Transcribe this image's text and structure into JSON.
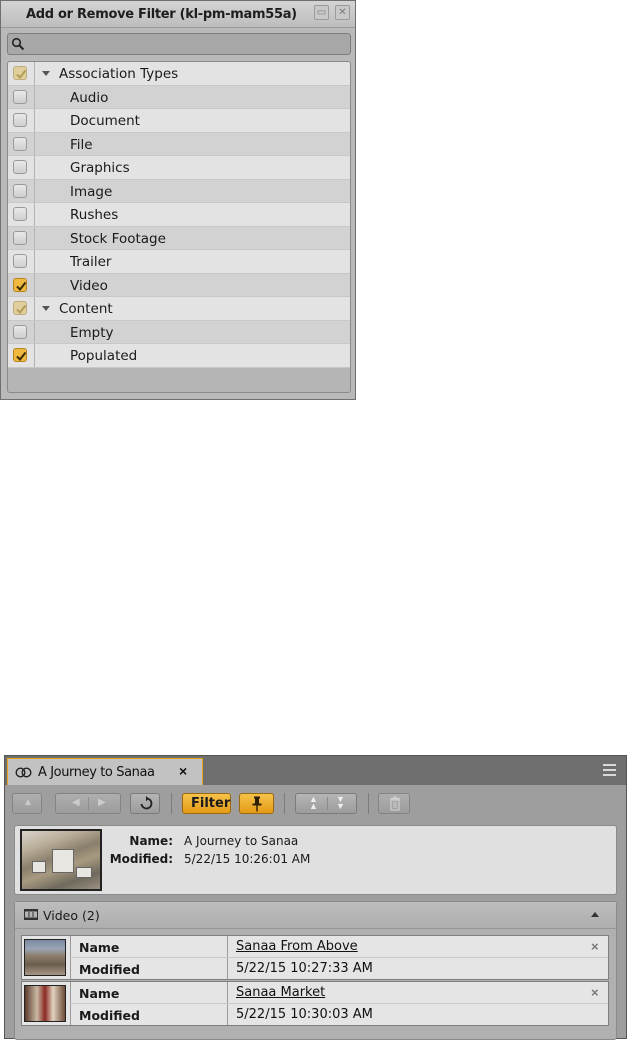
{
  "filter_dialog": {
    "title": "Add or Remove Filter  (kl-pm-mam55a)",
    "search": {
      "value": "",
      "placeholder": ""
    },
    "rows": [
      {
        "label": "Association Types",
        "state": "partial",
        "group": true
      },
      {
        "label": "Audio",
        "state": "unchecked",
        "group": false
      },
      {
        "label": "Document",
        "state": "unchecked",
        "group": false
      },
      {
        "label": "File",
        "state": "unchecked",
        "group": false
      },
      {
        "label": "Graphics",
        "state": "unchecked",
        "group": false
      },
      {
        "label": "Image",
        "state": "unchecked",
        "group": false
      },
      {
        "label": "Rushes",
        "state": "unchecked",
        "group": false
      },
      {
        "label": "Stock Footage",
        "state": "unchecked",
        "group": false
      },
      {
        "label": "Trailer",
        "state": "unchecked",
        "group": false
      },
      {
        "label": "Video",
        "state": "checked",
        "group": false
      },
      {
        "label": "Content",
        "state": "partial",
        "group": true
      },
      {
        "label": "Empty",
        "state": "unchecked",
        "group": false
      },
      {
        "label": "Populated",
        "state": "checked",
        "group": false
      }
    ]
  },
  "browse_panel": {
    "tab_title": "A Journey to Sanaa",
    "tab_close": "×",
    "toolbar": {
      "filter_label": "Filter"
    },
    "info": {
      "name_label": "Name:",
      "name_value": "A Journey to Sanaa",
      "modified_label": "Modified:",
      "modified_value": "5/22/15 10:26:01 AM"
    },
    "section": {
      "title": "Video (2)",
      "items": [
        {
          "name_label": "Name",
          "name_value": "Sanaa From Above",
          "modified_label": "Modified",
          "modified_value": "5/22/15 10:27:33 AM",
          "remove": "×"
        },
        {
          "name_label": "Name",
          "name_value": "Sanaa Market",
          "modified_label": "Modified",
          "modified_value": "5/22/15 10:30:03 AM",
          "remove": "×"
        }
      ]
    }
  },
  "colors": {
    "accent": "#f0b840",
    "checked": "#f0b840",
    "partial": "#e0cf9c"
  },
  "icons": [
    "search-icon",
    "chevron-down-icon",
    "link-icon",
    "menu-icon",
    "up-arrow-icon",
    "back-icon",
    "forward-icon",
    "refresh-icon",
    "pin-icon",
    "move-up-icon",
    "move-down-icon",
    "trash-icon",
    "film-icon",
    "collapse-icon",
    "close-icon"
  ]
}
